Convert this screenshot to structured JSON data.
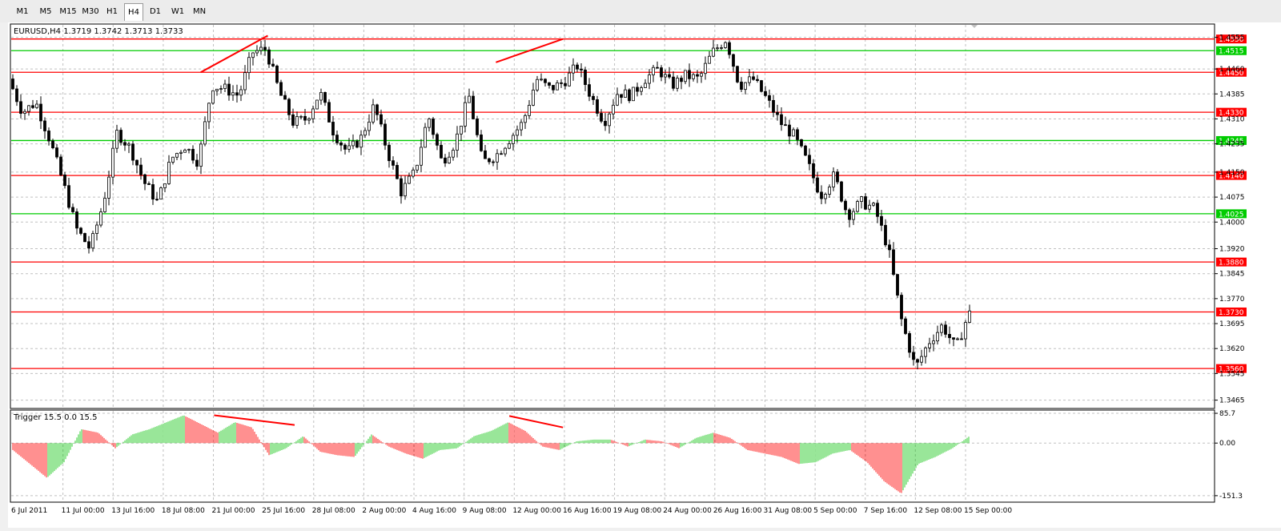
{
  "toolbar": {
    "timeframes": [
      "M1",
      "M5",
      "M15",
      "M30",
      "H1",
      "H4",
      "D1",
      "W1",
      "MN"
    ],
    "active": "H4"
  },
  "chart": {
    "header": "EURUSD,H4  1.3719 1.3742 1.3713 1.3733",
    "indicator_header": "Trigger 15.5 0.0 15.5"
  },
  "chart_data": {
    "type": "candlestick",
    "symbol": "EURUSD",
    "timeframe": "H4",
    "ohlc_last": {
      "open": 1.3719,
      "high": 1.3742,
      "low": 1.3713,
      "close": 1.3733
    },
    "price_axis_ticks": [
      "1.4555",
      "1.4460",
      "1.4385",
      "1.4310",
      "1.4235",
      "1.4150",
      "1.4075",
      "1.4000",
      "1.3920",
      "1.3845",
      "1.3770",
      "1.3695",
      "1.3620",
      "1.3545",
      "1.3465"
    ],
    "time_axis_labels": [
      "6 Jul 2011",
      "11 Jul 00:00",
      "13 Jul 16:00",
      "18 Jul 08:00",
      "21 Jul 00:00",
      "25 Jul 16:00",
      "28 Jul 08:00",
      "2 Aug 00:00",
      "4 Aug 16:00",
      "9 Aug 08:00",
      "12 Aug 00:00",
      "16 Aug 16:00",
      "19 Aug 08:00",
      "24 Aug 00:00",
      "26 Aug 16:00",
      "31 Aug 08:00",
      "5 Sep 00:00",
      "7 Sep 16:00",
      "12 Sep 08:00",
      "15 Sep 00:00"
    ],
    "horizontal_levels": [
      {
        "price": 1.455,
        "label": "1.4550",
        "color": "#ff0000"
      },
      {
        "price": 1.4515,
        "label": "1.4515",
        "color": "#00cc00"
      },
      {
        "price": 1.445,
        "label": "1.4450",
        "color": "#ff0000"
      },
      {
        "price": 1.433,
        "label": "1.4330",
        "color": "#ff0000"
      },
      {
        "price": 1.4245,
        "label": "1.4245",
        "color": "#00cc00"
      },
      {
        "price": 1.414,
        "label": "1.4140",
        "color": "#ff0000"
      },
      {
        "price": 1.4025,
        "label": "1.4025",
        "color": "#00cc00"
      },
      {
        "price": 1.388,
        "label": "1.3880",
        "color": "#ff0000"
      },
      {
        "price": 1.373,
        "label": "1.3730",
        "color": "#ff0000"
      },
      {
        "price": 1.356,
        "label": "1.3560",
        "color": "#ff0000"
      }
    ],
    "close_path": [
      1.443,
      1.433,
      1.436,
      1.425,
      1.412,
      1.398,
      1.392,
      1.406,
      1.427,
      1.422,
      1.412,
      1.406,
      1.419,
      1.423,
      1.418,
      1.441,
      1.44,
      1.438,
      1.451,
      1.452,
      1.439,
      1.43,
      1.431,
      1.439,
      1.427,
      1.421,
      1.425,
      1.435,
      1.421,
      1.409,
      1.415,
      1.432,
      1.418,
      1.424,
      1.438,
      1.418,
      1.42,
      1.425,
      1.43,
      1.443,
      1.44,
      1.442,
      1.447,
      1.438,
      1.43,
      1.439,
      1.438,
      1.443,
      1.446,
      1.441,
      1.444,
      1.443,
      1.451,
      1.455,
      1.441,
      1.443,
      1.437,
      1.43,
      1.426,
      1.418,
      1.408,
      1.414,
      1.402,
      1.406,
      1.404,
      1.392,
      1.37,
      1.356,
      1.364,
      1.369,
      1.362,
      1.3733
    ],
    "indicator": {
      "name": "Trigger",
      "params": "15.5 0.0 15.5",
      "axis_ticks": [
        "85.7",
        "0.00",
        "-151.3"
      ],
      "range": [
        -151.3,
        85.7
      ],
      "values": [
        -20,
        -60,
        -100,
        -55,
        40,
        30,
        -15,
        25,
        40,
        60,
        80,
        55,
        30,
        60,
        45,
        -35,
        -15,
        20,
        -25,
        -35,
        -40,
        25,
        -10,
        -30,
        -45,
        -20,
        -15,
        20,
        35,
        60,
        35,
        -10,
        -20,
        5,
        10,
        10,
        -10,
        10,
        5,
        -15,
        15,
        30,
        15,
        -20,
        -30,
        -40,
        -60,
        -55,
        -30,
        -20,
        -55,
        -110,
        -145,
        -60,
        -40,
        -15,
        20
      ]
    },
    "trend_annotations": [
      {
        "panel": "price",
        "from": [
          "20 Jul 2011",
          1.445
        ],
        "to": [
          "25 Jul 2011",
          1.456
        ]
      },
      {
        "panel": "price",
        "from": [
          "11 Aug 2011",
          1.448
        ],
        "to": [
          "16 Aug 2011",
          1.455
        ]
      },
      {
        "panel": "indicator",
        "from": [
          "21 Jul 2011",
          80
        ],
        "to": [
          "27 Jul 2011",
          52
        ]
      },
      {
        "panel": "indicator",
        "from": [
          "12 Aug 2011",
          78
        ],
        "to": [
          "16 Aug 2011",
          45
        ]
      }
    ]
  }
}
